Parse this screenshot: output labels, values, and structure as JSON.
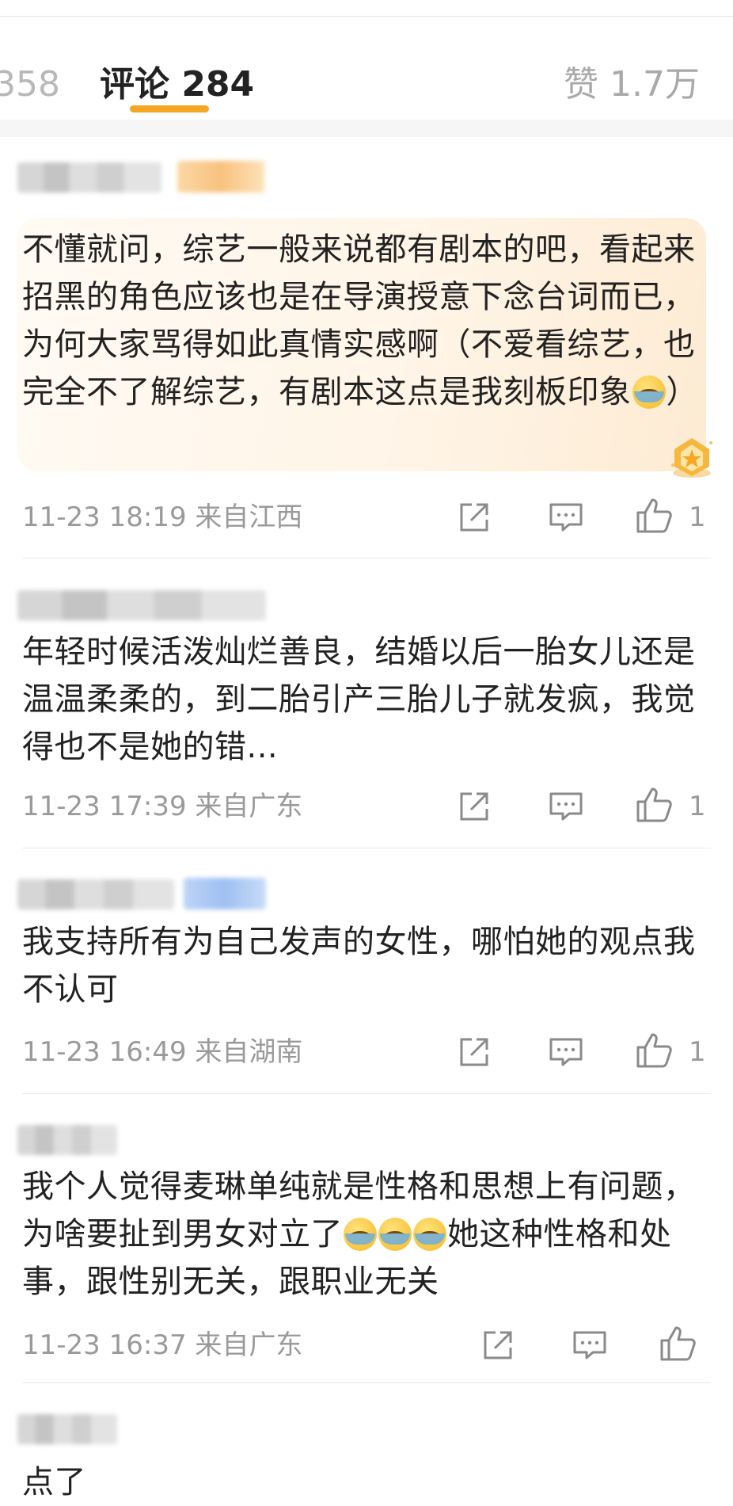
{
  "tabs": {
    "reposts": "358",
    "comments": "评论 284",
    "likes": "赞 1.7万"
  },
  "colors": {
    "accent_underline": "#f5a623",
    "meta_text": "#9a9a9a",
    "highlight_bg": "#fff5e8"
  },
  "icons": {
    "share": "share-icon",
    "reply": "comment-icon",
    "like": "thumbs-up-icon",
    "emoji": "laugh-cry-emoji"
  },
  "comments": [
    {
      "text": "不懂就问，综艺一般来说都有剧本的吧，看起来招黑的角色应该也是在导演授意下念台词而已，为何大家骂得如此真情实感啊（不爱看综艺，也完全不了解综艺，有剧本这点是我刻板印象",
      "text_tail": "）",
      "time": "11-23 18:19",
      "location": "来自江西",
      "likes": "1"
    },
    {
      "text": "年轻时候活泼灿烂善良，结婚以后一胎女儿还是温温柔柔的，到二胎引产三胎儿子就发疯，我觉得也不是她的错...",
      "time": "11-23 17:39",
      "location": "来自广东",
      "likes": "1"
    },
    {
      "text": "我支持所有为自己发声的女性，哪怕她的观点我不认可",
      "time": "11-23 16:49",
      "location": "来自湖南",
      "likes": "1"
    },
    {
      "text_a": "我个人觉得麦琳单纯就是性格和思想上有问题，为啥要扯到男女对立了",
      "text_b": "她这种性格和处事，跟性别无关，跟职业无关",
      "time": "11-23 16:37",
      "location": "来自广东",
      "likes": ""
    },
    {
      "text": "点了"
    }
  ]
}
